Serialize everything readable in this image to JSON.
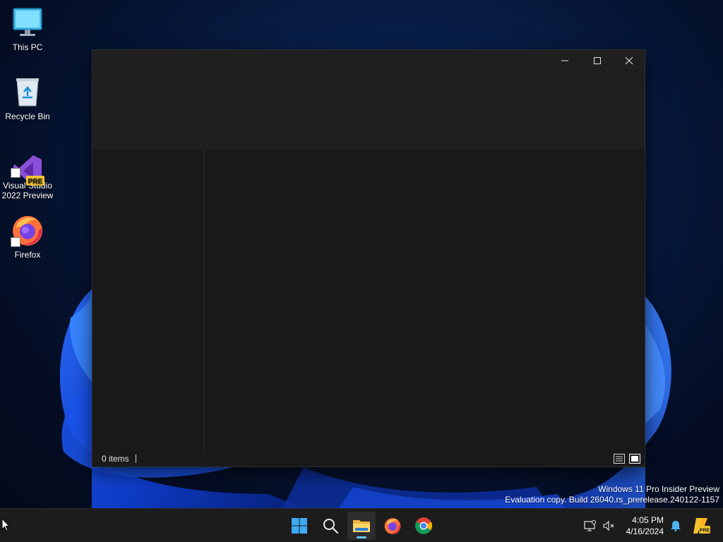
{
  "desktop": {
    "icons": [
      {
        "label": "This PC",
        "icon": "monitor-icon"
      },
      {
        "label": "Recycle Bin",
        "icon": "recycle-bin-icon"
      },
      {
        "label": "Visual Studio\n2022 Preview",
        "icon": "visual-studio-preview-icon",
        "badge": "PRE"
      },
      {
        "label": "Firefox",
        "icon": "firefox-icon"
      }
    ],
    "watermark": {
      "line1": "Windows 11 Pro Insider Preview",
      "line2": "Evaluation copy. Build 26040.rs_prerelease.240122-1157"
    }
  },
  "window": {
    "caption_buttons": [
      "minimize-icon",
      "maximize-icon",
      "close-icon"
    ],
    "status": {
      "items_text": "0 items",
      "view_buttons": [
        "details-view-icon",
        "large-icons-view-icon"
      ]
    }
  },
  "taskbar": {
    "apps": [
      {
        "name": "start",
        "icon": "windows-logo-icon"
      },
      {
        "name": "search",
        "icon": "search-icon"
      },
      {
        "name": "file-explorer",
        "icon": "folder-icon",
        "active": true
      },
      {
        "name": "firefox",
        "icon": "firefox-icon"
      },
      {
        "name": "chrome",
        "icon": "chrome-icon"
      }
    ],
    "tray": {
      "icons": [
        "network-icon",
        "volume-muted-icon",
        "notification-bell-icon",
        "dev-pre-icon"
      ],
      "time": "4:05 PM",
      "date": "4/16/2024"
    }
  },
  "colors": {
    "accent": "#60cdff",
    "window_bg": "#191919",
    "taskbar_bg": "#1c1c1c"
  }
}
